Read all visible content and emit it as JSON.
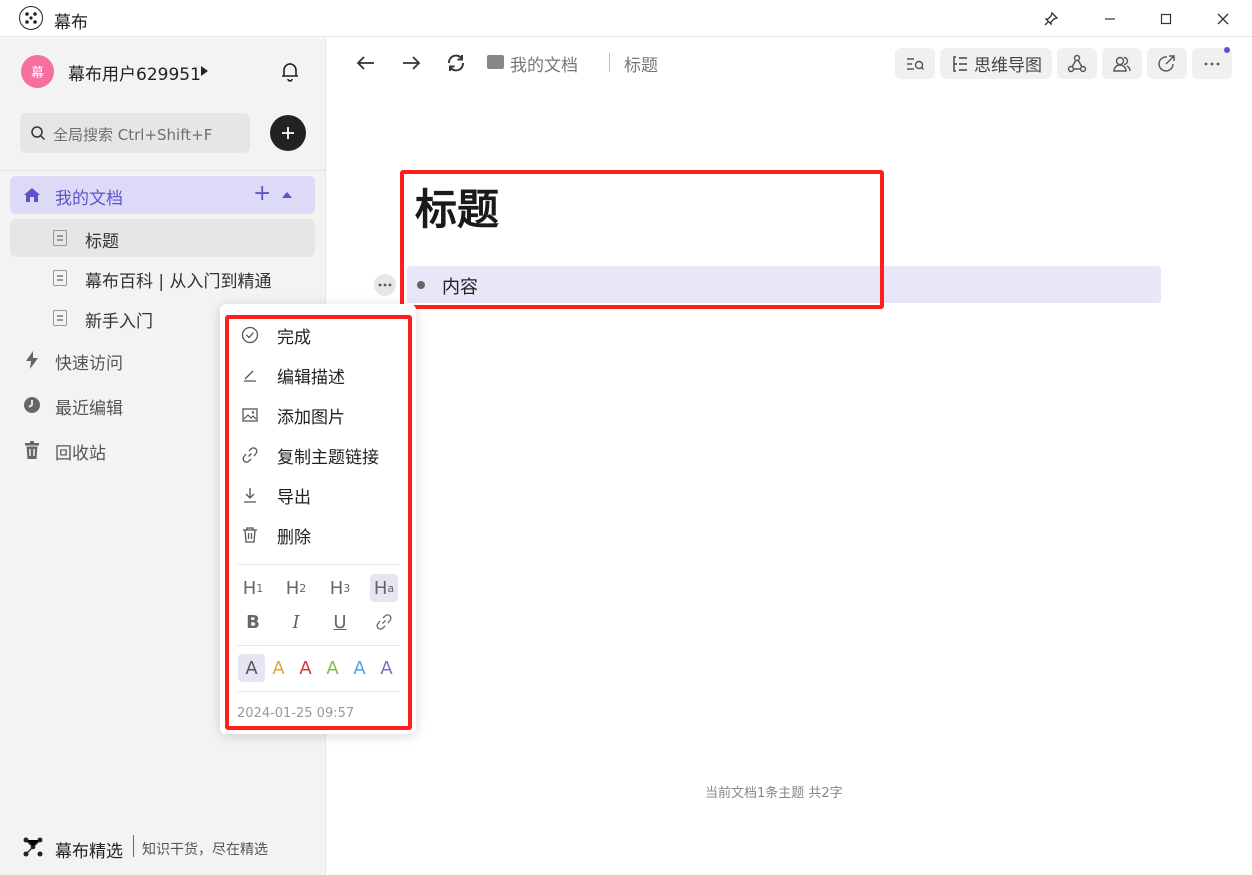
{
  "window": {
    "title": "幕布"
  },
  "sidebar": {
    "user": {
      "avatar_text": "幕",
      "name": "幕布用户629951"
    },
    "search": {
      "placeholder": "全局搜索 Ctrl+Shift+F"
    },
    "my_docs": "我的文档",
    "docs": [
      "标题",
      "幕布百科 | 从入门到精通",
      "新手入门"
    ],
    "quick_access": "快速访问",
    "recent": "最近编辑",
    "trash": "回收站",
    "footer": {
      "brand": "幕布精选",
      "tagline": "知识干货，尽在精选"
    }
  },
  "toolbar": {
    "breadcrumb_root": "我的文档",
    "breadcrumb_current": "标题",
    "mindmap_label": "思维导图"
  },
  "document": {
    "title": "标题",
    "content": "内容",
    "stats": "当前文档1条主题 共2字"
  },
  "context_menu": {
    "items": [
      "完成",
      "编辑描述",
      "添加图片",
      "复制主题链接",
      "导出",
      "删除"
    ],
    "headings": [
      "H",
      "H",
      "H",
      "H"
    ],
    "heading_subs": [
      "1",
      "2",
      "3",
      "a"
    ],
    "styles": [
      "B",
      "I",
      "U"
    ],
    "color_letter": "A",
    "colors": [
      "#555555",
      "#e0a43a",
      "#d43a2f",
      "#7bc045",
      "#4aa4e8",
      "#7b6cc9"
    ],
    "timestamp": "2024-01-25 09:57"
  },
  "colors": {
    "accent": "#5b55c9",
    "highlight": "#ff1f1f"
  }
}
